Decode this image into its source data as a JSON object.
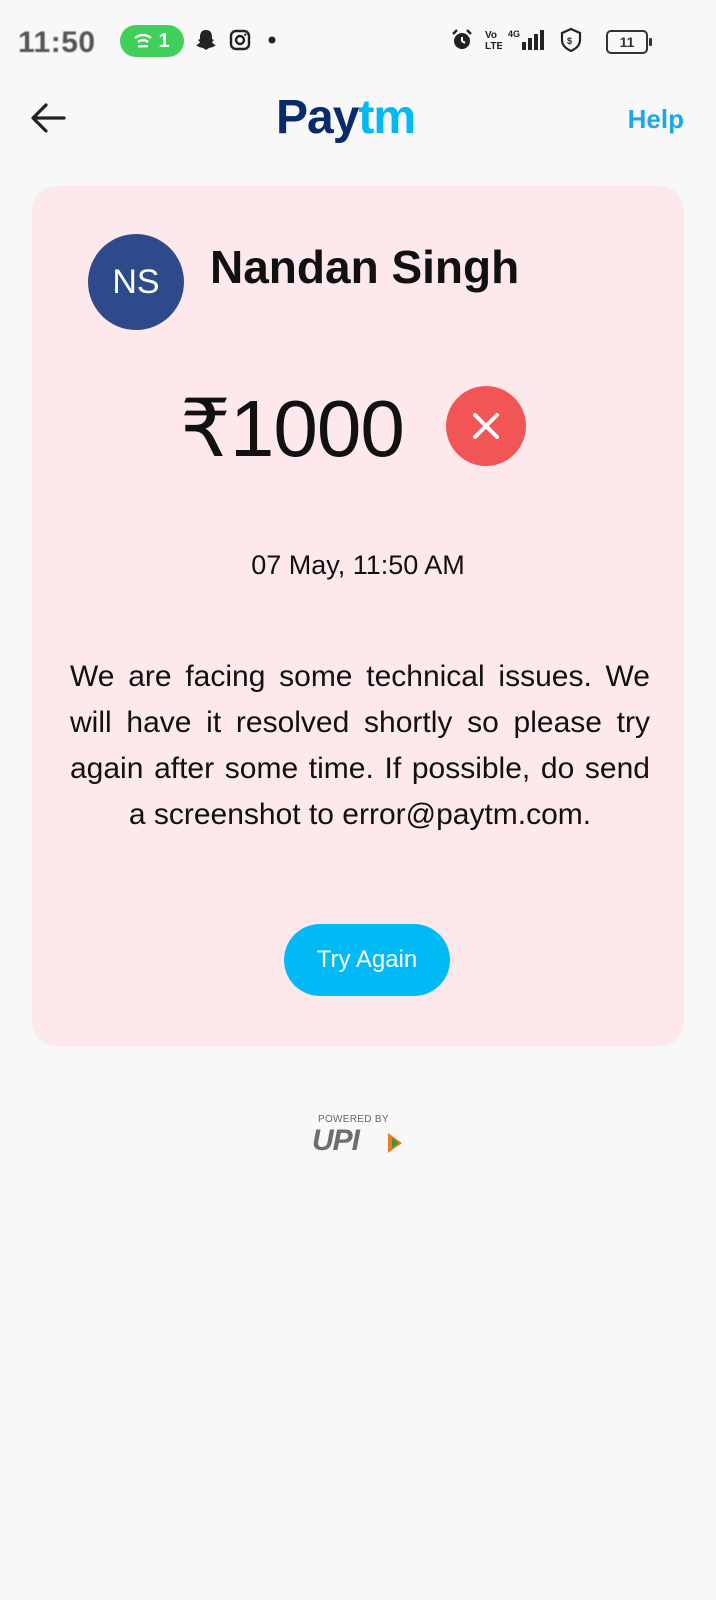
{
  "status_bar": {
    "time": "11:50",
    "hotspot_count": "1",
    "battery": "11",
    "icons": [
      "wifi-hotspot-icon",
      "snapchat-icon",
      "instagram-icon",
      "dot-icon",
      "alarm-icon",
      "volte-icon",
      "signal-icon",
      "vpn-shield-icon",
      "battery-icon"
    ]
  },
  "header": {
    "brand_pay": "Pay",
    "brand_tm": "tm",
    "help_label": "Help",
    "back_icon": "arrow-left-icon"
  },
  "transaction": {
    "avatar_initials": "NS",
    "payee_name": "Nandan Singh",
    "amount": "₹1000",
    "status_icon": "close-icon",
    "status_color": "#f25555",
    "datetime": "07 May, 11:50 AM",
    "message": "We are facing some technical issues. We will have it resolved shortly so please try again after some time. If possible, do send a screenshot to error@paytm.com.",
    "try_again_label": "Try Again"
  },
  "footer": {
    "powered_by": "POWERED BY",
    "upi": "UPI"
  },
  "colors": {
    "brand_dark": "#0a2b6b",
    "brand_light": "#00b9f5",
    "card_bg": "#fde8ec",
    "avatar_bg": "#2f4a8a"
  }
}
